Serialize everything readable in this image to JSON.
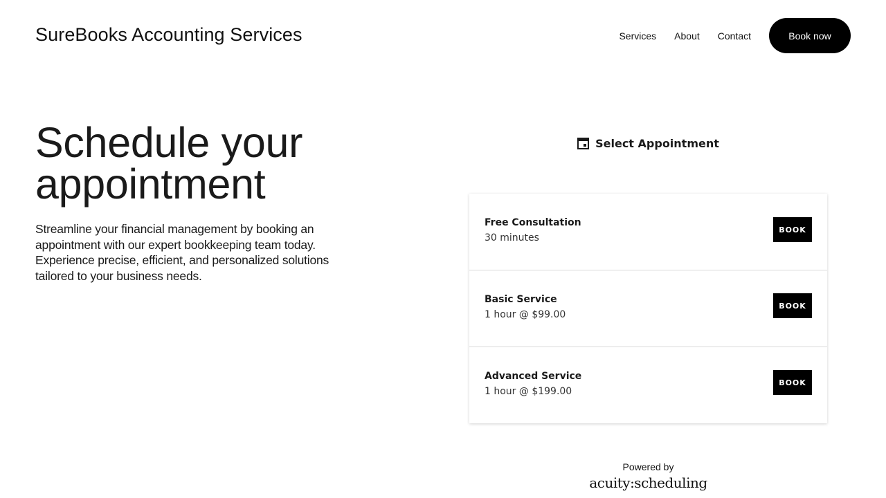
{
  "header": {
    "brand": "SureBooks Accounting Services",
    "nav": [
      "Services",
      "About",
      "Contact"
    ],
    "cta_label": "Book now"
  },
  "hero": {
    "title": "Schedule your appointment",
    "description": "Streamline your financial management by booking an appointment with our expert bookkeeping team today. Experience precise, efficient, and personalized solutions tailored to your business needs."
  },
  "scheduler": {
    "heading": "Select Appointment",
    "heading_icon": "calendar-icon",
    "appointments": [
      {
        "name": "Free Consultation",
        "detail": "30 minutes",
        "button": "BOOK"
      },
      {
        "name": "Basic Service",
        "detail": "1 hour @ $99.00",
        "button": "BOOK"
      },
      {
        "name": "Advanced Service",
        "detail": "1 hour @ $199.00",
        "button": "BOOK"
      }
    ],
    "powered_by": "Powered by",
    "logo_text": "acuity:scheduling"
  },
  "colors": {
    "background": "#ffffff",
    "text": "#111111",
    "button": "#000000",
    "button_text": "#ffffff"
  }
}
